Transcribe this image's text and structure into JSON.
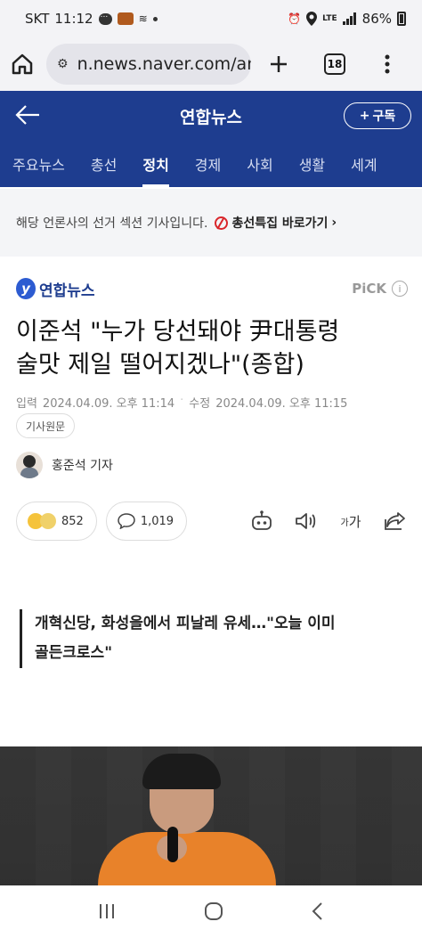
{
  "status_bar": {
    "carrier": "SKT",
    "time": "11:12",
    "network": "LTE",
    "battery": "86%"
  },
  "browser": {
    "url": "n.news.naver.com/ar",
    "tab_count": "18"
  },
  "header": {
    "title": "연합뉴스",
    "subscribe_label": "구독"
  },
  "nav_tabs": [
    {
      "label": "주요뉴스"
    },
    {
      "label": "총선"
    },
    {
      "label": "정치",
      "active": true
    },
    {
      "label": "경제"
    },
    {
      "label": "사회"
    },
    {
      "label": "생활"
    },
    {
      "label": "세계"
    }
  ],
  "election_banner": {
    "text": "해당 언론사의 선거 섹션 기사입니다.",
    "link": "총선특집 바로가기"
  },
  "press": {
    "name": "연합뉴스",
    "pick": "PiCK"
  },
  "article": {
    "headline_line1": "이준석 \"누가 당선돼야 尹대통령",
    "headline_line2": "술맛 제일 떨어지겠나\"(종합)",
    "input_label": "입력",
    "input_date": "2024.04.09. 오후 11:14",
    "edit_label": "수정",
    "edit_date": "2024.04.09. 오후 11:15",
    "original_label": "기사원문",
    "reporter": "홍준석 기자"
  },
  "actions": {
    "reactions_count": "852",
    "comments_count": "1,019",
    "font_small": "가",
    "font_large": "가"
  },
  "subheading": {
    "line1": "개혁신당, 화성을에서 피날레 유세…\"오늘 이미",
    "line2": "골든크로스\""
  },
  "colors": {
    "brand": "#1e3d8f",
    "accent_red": "#d9262b"
  }
}
